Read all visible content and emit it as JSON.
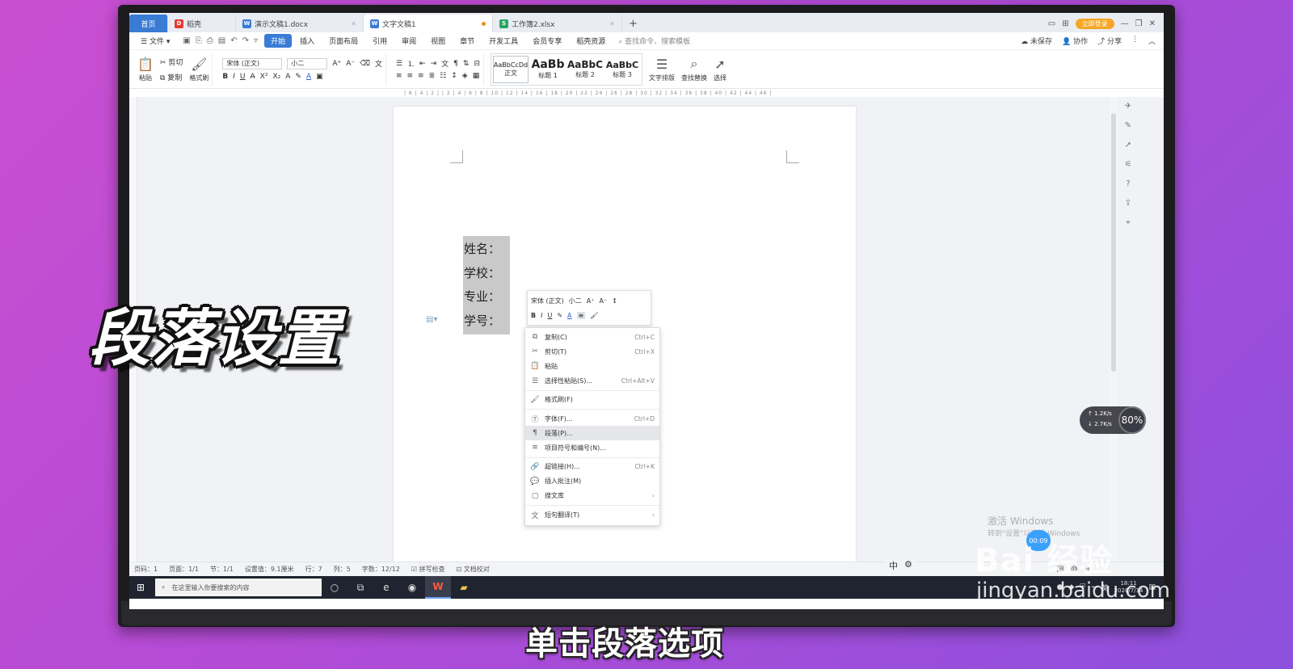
{
  "tabs": [
    {
      "label": "首页",
      "kind": "home"
    },
    {
      "label": "稻壳",
      "icon_color": "#e33b2f",
      "icon_glyph": "D"
    },
    {
      "label": "演示文稿1.docx",
      "icon_color": "#3a7bd5",
      "icon_glyph": "W"
    },
    {
      "label": "文字文稿1",
      "icon_color": "#3a7bd5",
      "icon_glyph": "W",
      "active": true
    },
    {
      "label": "工作簿2.xlsx",
      "icon_color": "#2aa561",
      "icon_glyph": "S"
    }
  ],
  "header": {
    "login": "立即登录"
  },
  "menu": {
    "file": "文件",
    "items": [
      "开始",
      "插入",
      "页面布局",
      "引用",
      "审阅",
      "视图",
      "章节",
      "开发工具",
      "会员专享",
      "稻壳资源"
    ],
    "active": "开始",
    "search": "查找命令、搜索模板",
    "unsaved": "未保存",
    "collab": "协作",
    "share": "分享"
  },
  "ribbon": {
    "paste": "粘贴",
    "cut": "剪切",
    "copy": "复制",
    "format_painter": "格式刷",
    "font_name": "宋体 (正文)",
    "font_size": "小二",
    "styles": [
      {
        "preview": "AaBbCcDd",
        "label": "正文"
      },
      {
        "preview": "AaBb",
        "label": "标题 1"
      },
      {
        "preview": "AaBbC",
        "label": "标题 2"
      },
      {
        "preview": "AaBbC",
        "label": "标题 3"
      }
    ],
    "text_layout": "文字排版",
    "find_replace": "查找替换",
    "select": "选择"
  },
  "ruler_text": "| 6 | 4 | 2 | | 2 | 4 | 6 | 8 | 10 | 12 | 14 | 16 | 18 | 20 | 22 | 24 | 26 | 28 | 30 | 32 | 34 | 36 | 38 | 40 | 42 | 44 | 46 |",
  "document": {
    "lines": [
      "姓名：",
      "学校：",
      "专业：",
      "学号："
    ]
  },
  "mini_toolbar": {
    "font": "宋体 (正文)",
    "size": "小二"
  },
  "context_menu": [
    {
      "icon": "⧉",
      "icon_name": "copy-icon",
      "label": "复制(C)",
      "shortcut": "Ctrl+C"
    },
    {
      "icon": "✂",
      "icon_name": "cut-icon",
      "label": "剪切(T)",
      "shortcut": "Ctrl+X"
    },
    {
      "icon": "📋",
      "icon_name": "paste-icon",
      "label": "粘贴",
      "shortcut": ""
    },
    {
      "icon": "☰",
      "icon_name": "paste-special-icon",
      "label": "选择性粘贴(S)...",
      "shortcut": "Ctrl+Alt+V"
    },
    {
      "sep": true
    },
    {
      "icon": "🖌",
      "icon_name": "format-painter-icon",
      "label": "格式刷(F)",
      "shortcut": ""
    },
    {
      "sep": true
    },
    {
      "icon": "Ⓣ",
      "icon_name": "font-icon",
      "label": "字体(F)...",
      "shortcut": "Ctrl+D"
    },
    {
      "icon": "¶",
      "icon_name": "paragraph-icon",
      "label": "段落(P)...",
      "shortcut": "",
      "highlight": true
    },
    {
      "icon": "≡",
      "icon_name": "bullets-icon",
      "label": "项目符号和编号(N)...",
      "shortcut": ""
    },
    {
      "sep": true
    },
    {
      "icon": "🔗",
      "icon_name": "link-icon",
      "label": "超链接(H)...",
      "shortcut": "Ctrl+K"
    },
    {
      "icon": "💬",
      "icon_name": "comment-icon",
      "label": "插入批注(M)",
      "shortcut": ""
    },
    {
      "icon": "▢",
      "icon_name": "library-icon",
      "label": "搜文库",
      "shortcut": "›"
    },
    {
      "sep": true
    },
    {
      "icon": "文",
      "icon_name": "translate-icon",
      "label": "短句翻译(T)",
      "shortcut": "›"
    }
  ],
  "status": {
    "page_num": "页码：1",
    "pages": "页面：1/1",
    "section": "节：1/1",
    "position": "设置值：9.1厘米",
    "row": "行：7",
    "col": "列：5",
    "words": "字数：12/12",
    "spell": "拼写检查",
    "proof": "文档校对"
  },
  "ime": {
    "lang": "中"
  },
  "taskbar": {
    "search_placeholder": "在这里输入你要搜索的内容",
    "time": "18:11",
    "date": "2020/7/14",
    "lang": "英"
  },
  "net": {
    "up": "1.2K/s",
    "down": "2.7K/s",
    "cpu": "80%"
  },
  "recording": "00:09",
  "windows_watermark": {
    "line1": "激活 Windows",
    "line2": "转到\"设置\"以激活 Windows"
  },
  "overlay": {
    "title": "段落设置",
    "subtitle": "单击段落选项"
  },
  "brand": {
    "name": "Bai 经验",
    "url": "jingyan.baidu.com"
  }
}
